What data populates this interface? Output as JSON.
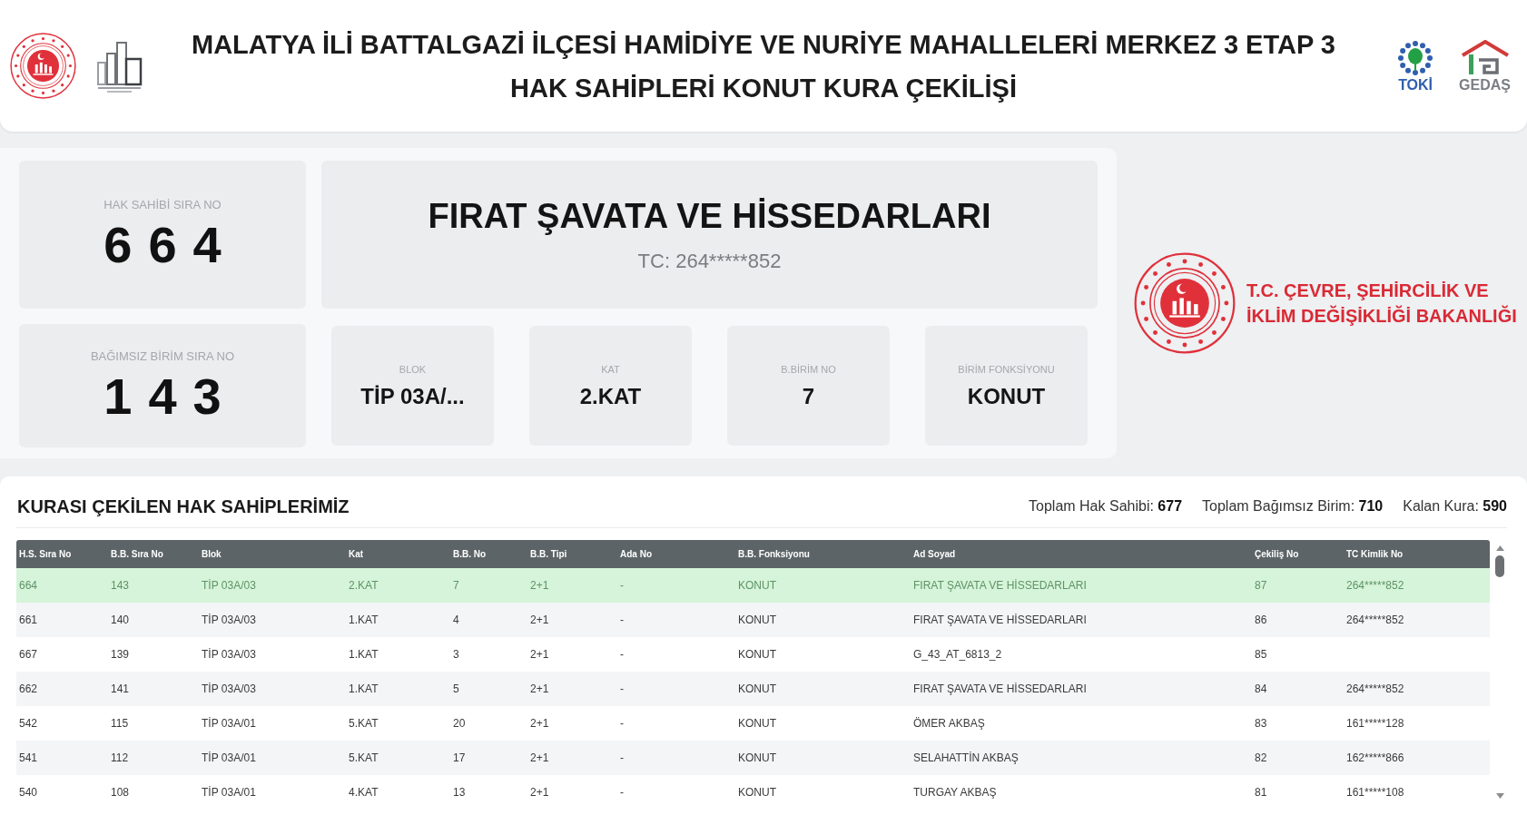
{
  "header": {
    "title_lines": [
      "MALATYA İLİ BATTALGAZİ İLÇESİ HAMİDİYE VE NURİYE MAHALLELERİ MERKEZ 3 ETAP 3",
      "HAK SAHİPLERİ KONUT KURA ÇEKİLİŞİ"
    ],
    "logos": [
      {
        "kind": "dots",
        "label": "TOKİ"
      },
      {
        "kind": "house",
        "label": "GEDAŞ"
      }
    ]
  },
  "current_draw": {
    "holder_no": {
      "label": "HAK SAHİBİ SIRA NO",
      "value": "664"
    },
    "holder_name": "FIRAT ŞAVATA VE HİSSEDARLARI",
    "holder_tc": "TC: 264*****852",
    "unit_no": {
      "label": "BAĞIMSIZ BİRİM SIRA NO",
      "value": "143"
    },
    "details": [
      {
        "label": "BLOK",
        "value": "TİP 03A/..."
      },
      {
        "label": "KAT",
        "value": "2.KAT"
      },
      {
        "label": "B.BİRİM NO",
        "value": "7"
      },
      {
        "label": "BİRİM FONKSİYONU",
        "value": "KONUT"
      }
    ]
  },
  "ministry": {
    "name_lines": [
      "T.C. ÇEVRE, ŞEHİRCİLİK VE",
      "İKLİM DEĞİŞİKLİĞİ BAKANLIĞI"
    ]
  },
  "results": {
    "title": "KURASI ÇEKİLEN HAK SAHİPLERİMİZ",
    "stats": [
      {
        "label": "Toplam Hak Sahibi:",
        "value": "677"
      },
      {
        "label": "Toplam Bağımsız Birim:",
        "value": "710"
      },
      {
        "label": "Kalan Kura:",
        "value": "590"
      }
    ],
    "table": {
      "columns": [
        "H.S. Sıra No",
        "B.B. Sıra No",
        "Blok",
        "Kat",
        "B.B. No",
        "B.B. Tipi",
        "Ada No",
        "B.B. Fonksiyonu",
        "Ad Soyad",
        "Çekiliş No",
        "TC Kimlik No"
      ],
      "rows": [
        {
          "selected": true,
          "hs_sira_no": "664",
          "bb_sira_no": "143",
          "blok": "TİP 03A/03",
          "kat": "2.KAT",
          "bb_no": "7",
          "bb_tipi": "2+1",
          "ada_no": "-",
          "bb_fonksiyonu": "KONUT",
          "ad_soyad": "FIRAT ŞAVATA VE HİSSEDARLARI",
          "cekilis_no": "87",
          "tc_kimlik_no": "264*****852"
        },
        {
          "selected": false,
          "hs_sira_no": "661",
          "bb_sira_no": "140",
          "blok": "TİP 03A/03",
          "kat": "1.KAT",
          "bb_no": "4",
          "bb_tipi": "2+1",
          "ada_no": "-",
          "bb_fonksiyonu": "KONUT",
          "ad_soyad": "FIRAT ŞAVATA VE HİSSEDARLARI",
          "cekilis_no": "86",
          "tc_kimlik_no": "264*****852"
        },
        {
          "selected": false,
          "hs_sira_no": "667",
          "bb_sira_no": "139",
          "blok": "TİP 03A/03",
          "kat": "1.KAT",
          "bb_no": "3",
          "bb_tipi": "2+1",
          "ada_no": "-",
          "bb_fonksiyonu": "KONUT",
          "ad_soyad": "G_43_AT_6813_2",
          "cekilis_no": "85"
        },
        {
          "selected": false,
          "hs_sira_no": "662",
          "bb_sira_no": "141",
          "blok": "TİP 03A/03",
          "kat": "1.KAT",
          "bb_no": "5",
          "bb_tipi": "2+1",
          "ada_no": "-",
          "bb_fonksiyonu": "KONUT",
          "ad_soyad": "FIRAT ŞAVATA VE HİSSEDARLARI",
          "cekilis_no": "84",
          "tc_kimlik_no": "264*****852"
        },
        {
          "selected": false,
          "hs_sira_no": "542",
          "bb_sira_no": "115",
          "blok": "TİP 03A/01",
          "kat": "5.KAT",
          "bb_no": "20",
          "bb_tipi": "2+1",
          "ada_no": "-",
          "bb_fonksiyonu": "KONUT",
          "ad_soyad": "ÖMER AKBAŞ",
          "cekilis_no": "83",
          "tc_kimlik_no": "161*****128"
        },
        {
          "selected": false,
          "hs_sira_no": "541",
          "bb_sira_no": "112",
          "blok": "TİP 03A/01",
          "kat": "5.KAT",
          "bb_no": "17",
          "bb_tipi": "2+1",
          "ada_no": "-",
          "bb_fonksiyonu": "KONUT",
          "ad_soyad": "SELAHATTİN AKBAŞ",
          "cekilis_no": "82",
          "tc_kimlik_no": "162*****866"
        },
        {
          "selected": false,
          "hs_sira_no": "540",
          "bb_sira_no": "108",
          "blok": "TİP 03A/01",
          "kat": "4.KAT",
          "bb_no": "13",
          "bb_tipi": "2+1",
          "ada_no": "-",
          "bb_fonksiyonu": "KONUT",
          "ad_soyad": "TURGAY AKBAŞ",
          "cekilis_no": "81",
          "tc_kimlik_no": "161*****108"
        }
      ]
    }
  }
}
